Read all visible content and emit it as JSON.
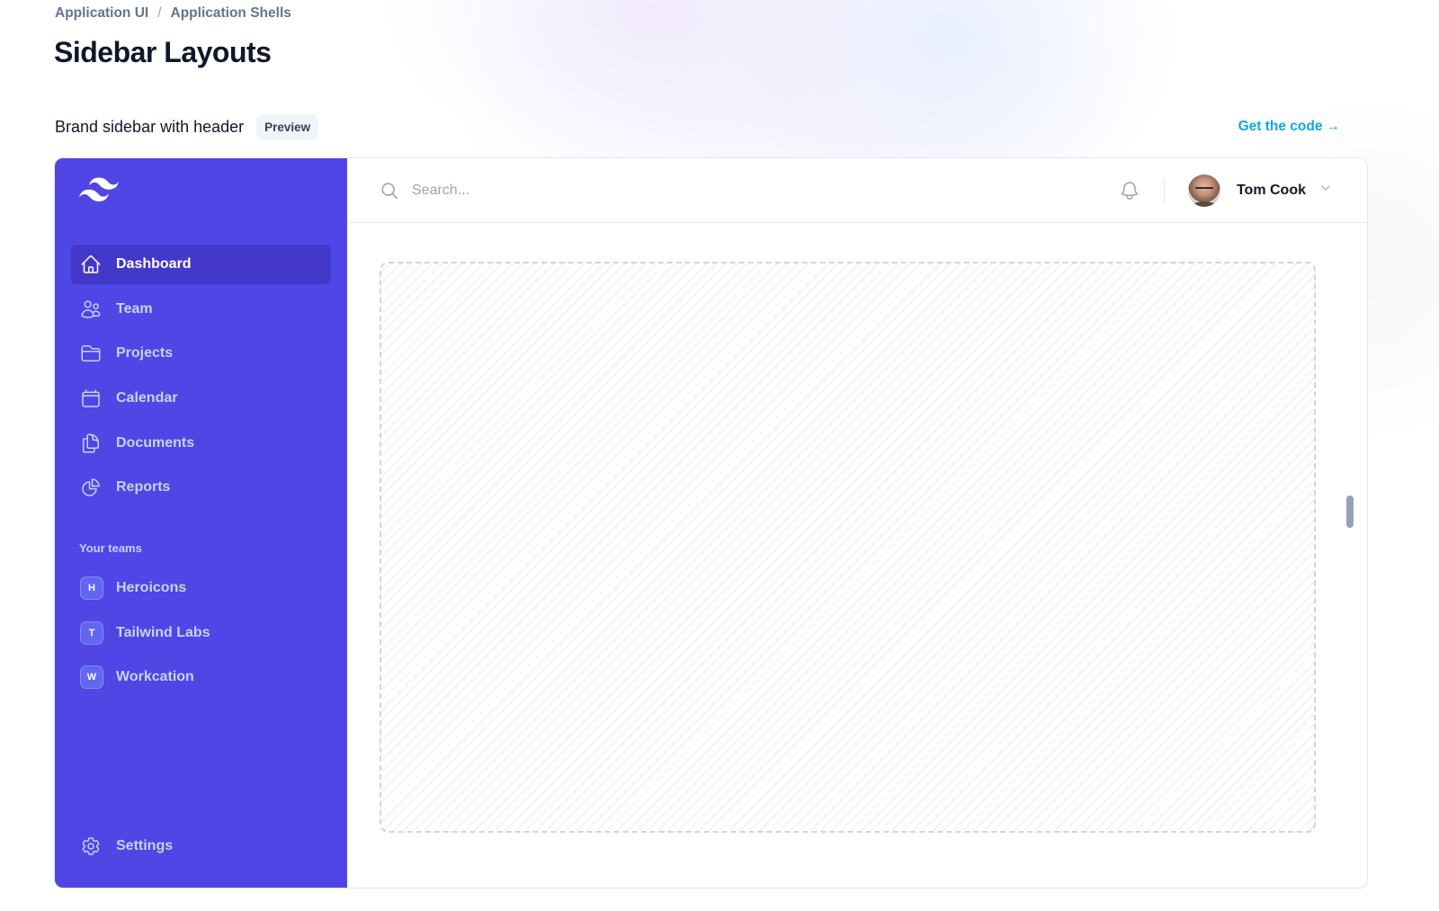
{
  "breadcrumb": {
    "items": [
      "Application UI",
      "Application Shells"
    ],
    "separator": "/"
  },
  "page_title": "Sidebar Layouts",
  "example": {
    "title": "Brand sidebar with header",
    "badge": "Preview",
    "get_code_label": "Get the code",
    "get_code_arrow": "→"
  },
  "colors": {
    "brand": "#4f46e5",
    "brand_active": "#4338ca",
    "link": "#0ea5e9"
  },
  "sidebar": {
    "logo": "tailwind-logo",
    "nav": [
      {
        "label": "Dashboard",
        "icon": "home-icon",
        "active": true
      },
      {
        "label": "Team",
        "icon": "users-icon",
        "active": false
      },
      {
        "label": "Projects",
        "icon": "folder-icon",
        "active": false
      },
      {
        "label": "Calendar",
        "icon": "calendar-icon",
        "active": false
      },
      {
        "label": "Documents",
        "icon": "documents-icon",
        "active": false
      },
      {
        "label": "Reports",
        "icon": "chart-pie-icon",
        "active": false
      }
    ],
    "teams_heading": "Your teams",
    "teams": [
      {
        "initial": "H",
        "label": "Heroicons"
      },
      {
        "initial": "T",
        "label": "Tailwind Labs"
      },
      {
        "initial": "W",
        "label": "Workcation"
      }
    ],
    "settings": {
      "label": "Settings",
      "icon": "cog-icon"
    }
  },
  "topbar": {
    "search_placeholder": "Search...",
    "search_value": "",
    "notifications_icon": "bell-icon",
    "user": {
      "name": "Tom Cook",
      "avatar": "avatar-photo"
    }
  }
}
